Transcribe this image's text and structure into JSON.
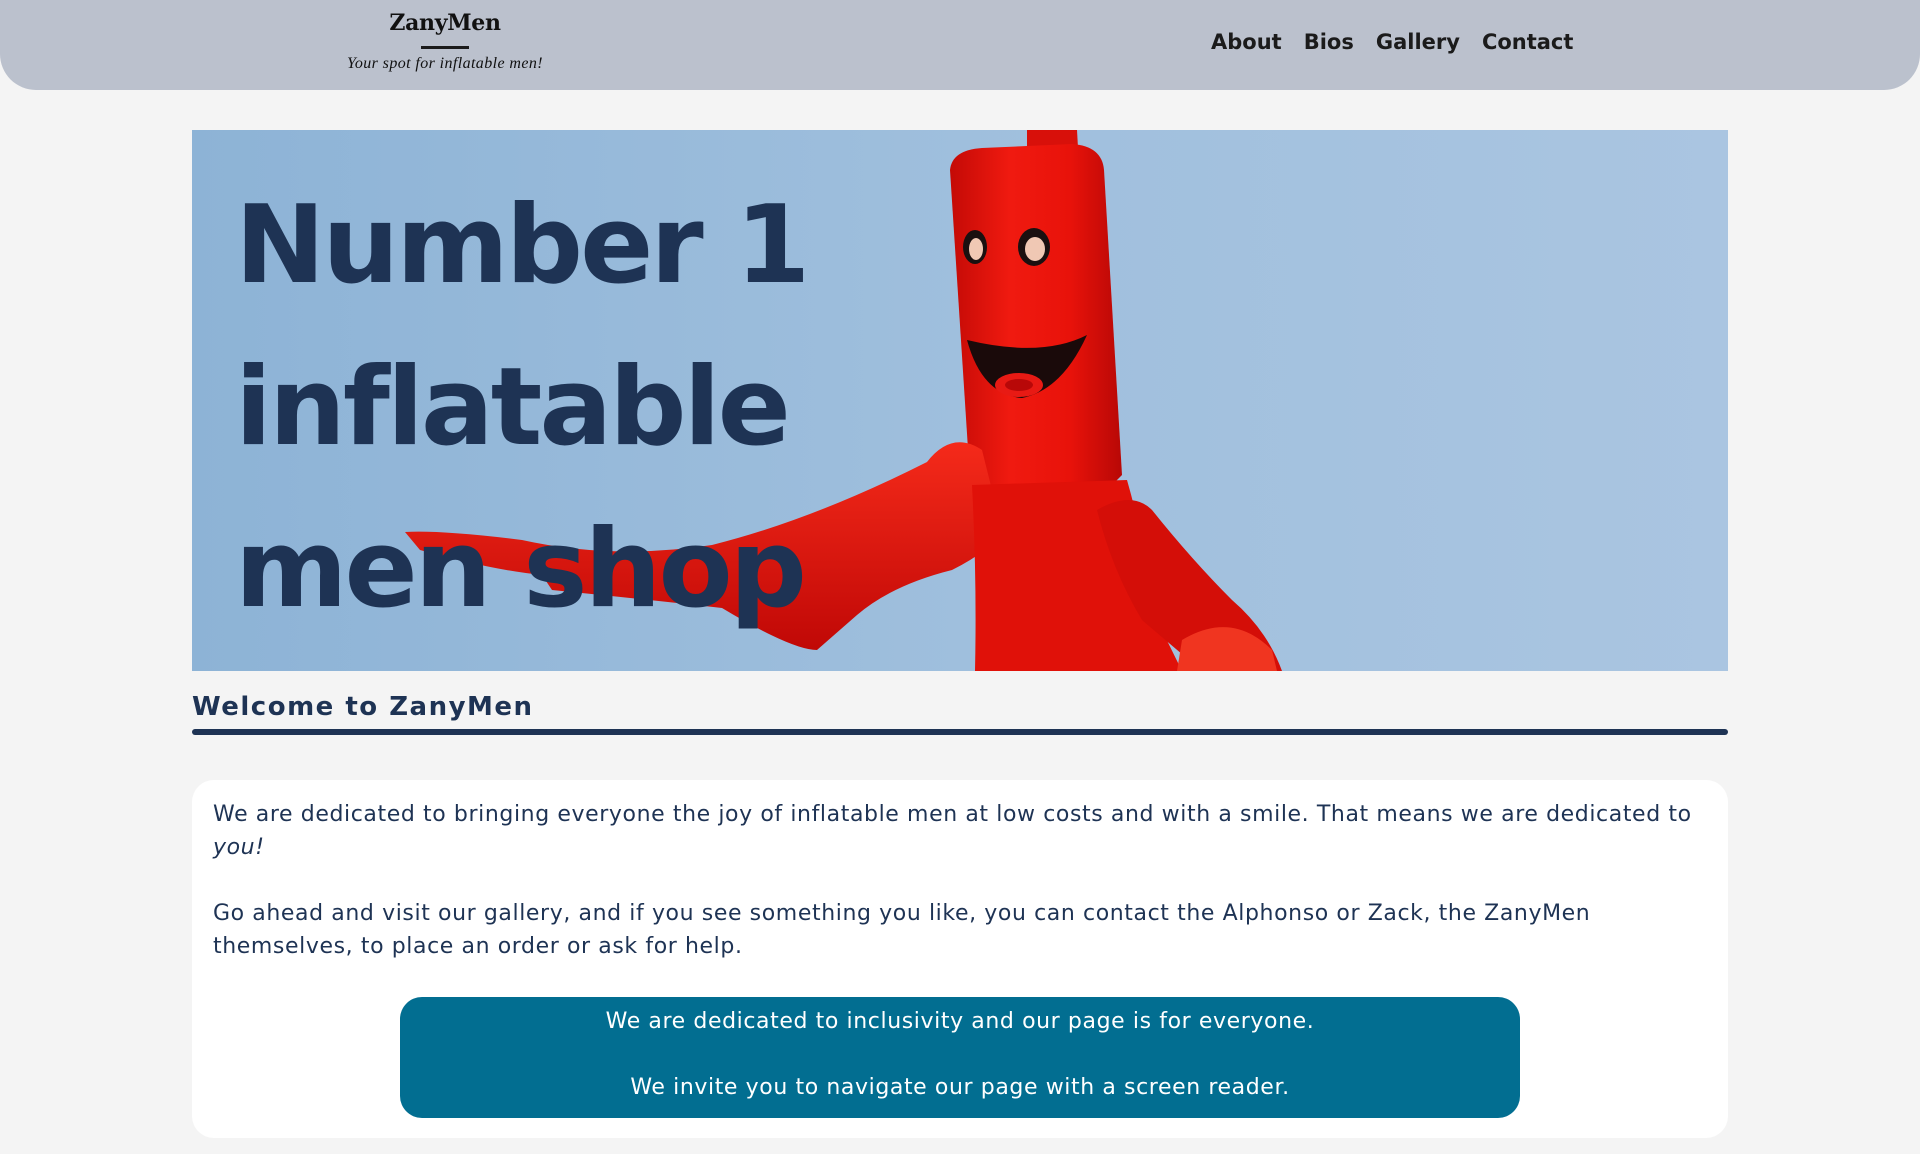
{
  "header": {
    "logo_name": "ZanyMen",
    "logo_tagline": "Your spot for inflatable men!",
    "nav": [
      {
        "label": "About"
      },
      {
        "label": "Bios"
      },
      {
        "label": "Gallery"
      },
      {
        "label": "Contact"
      }
    ]
  },
  "hero": {
    "headline_lines": [
      "Number 1",
      "inflatable",
      "men shop"
    ],
    "image_subject": "red inflatable tube man against a blue sky"
  },
  "welcome": {
    "title": "Welcome to ZanyMen",
    "para1_text": "We are dedicated to bringing everyone the joy of inflatable men at low costs and with a smile. That means we are dedicated to ",
    "para1_emphasis": "you!",
    "para2": "Go ahead and visit our gallery, and if you see something you like, you can contact the Alphonso or Zack, the ZanyMen themselves, to place an order or ask for help."
  },
  "notice": {
    "line1": "We are dedicated to inclusivity and our page is for everyone.",
    "line2": "We invite you to navigate our page with a screen reader."
  },
  "colors": {
    "header_bg": "#bbc1cd",
    "page_bg": "#f4f4f4",
    "navy": "#1e3354",
    "notice_bg": "#026e91",
    "sky": "#9fbfdd",
    "tube_red": "#e8120a"
  }
}
